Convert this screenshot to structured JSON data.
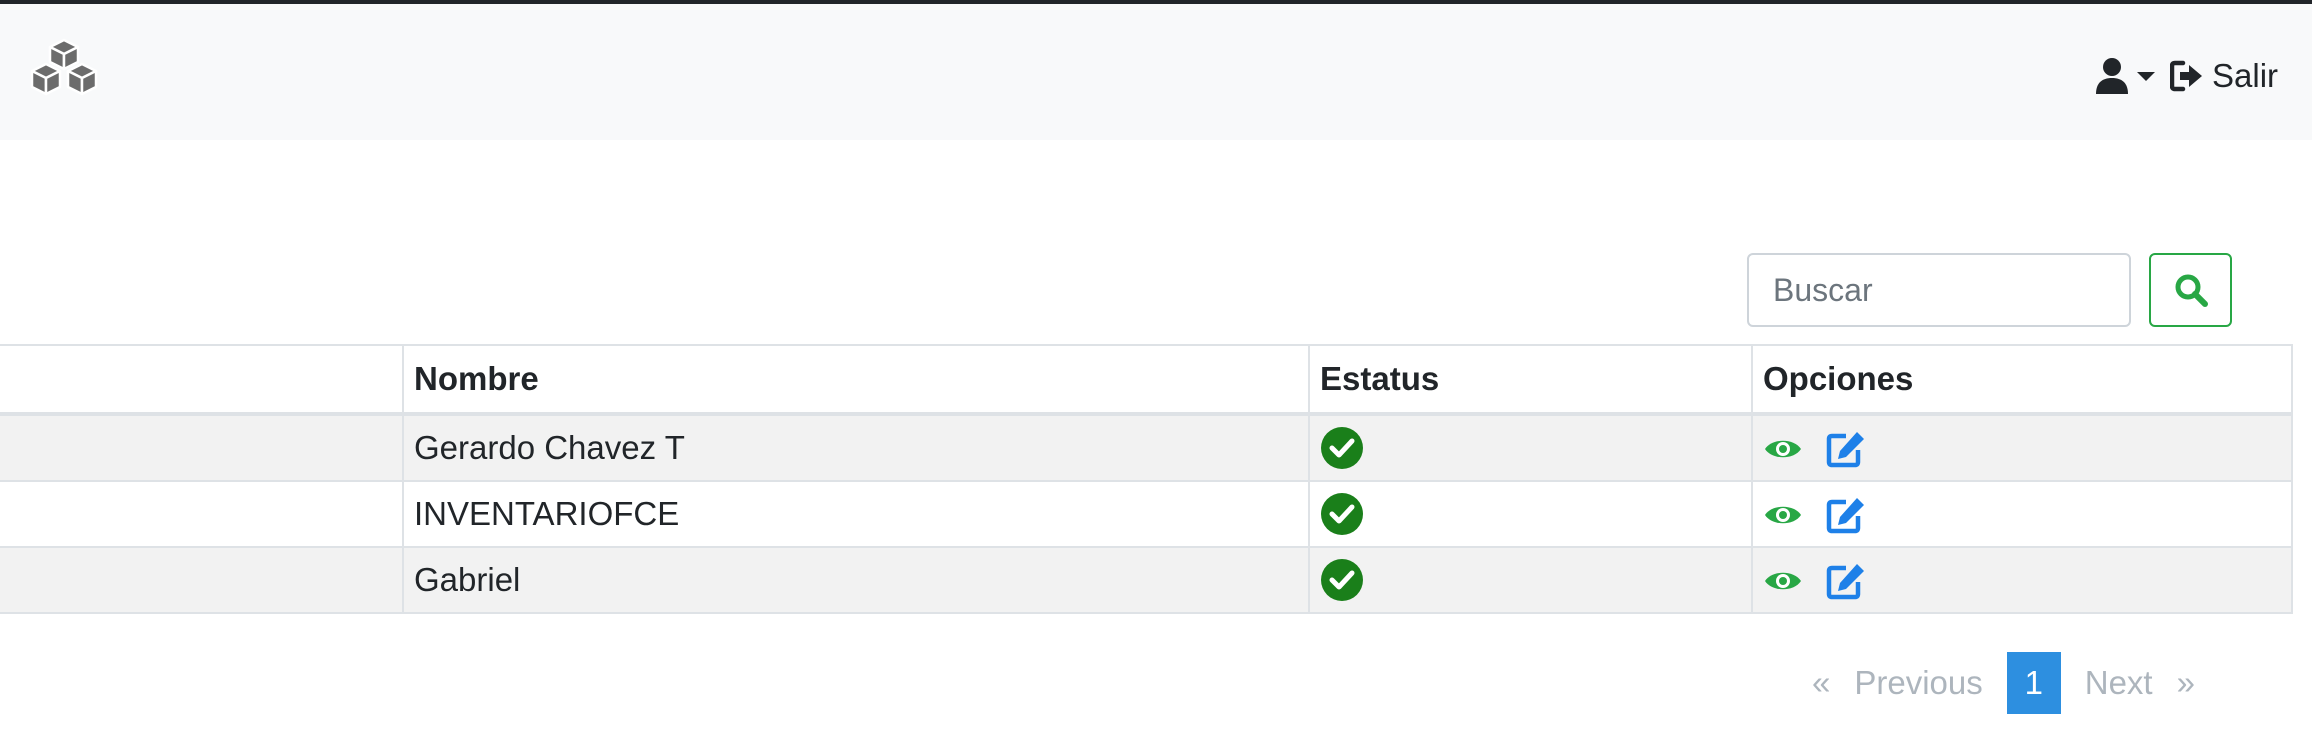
{
  "header": {
    "logo_icon": "cubes-icon",
    "user_icon": "user-icon",
    "dropdown_icon": "caret-down-icon",
    "logout_icon": "sign-out-icon",
    "logout_label": "Salir"
  },
  "search": {
    "placeholder": "Buscar",
    "value": "",
    "button_icon": "search-icon",
    "accent_color": "#28a745"
  },
  "table": {
    "columns": [
      "",
      "Nombre",
      "Estatus",
      "Opciones"
    ],
    "rows": [
      {
        "id": "",
        "nombre": "Gerardo Chavez T",
        "estatus_icon": "check-circle-icon",
        "options": [
          "eye-icon",
          "edit-icon"
        ]
      },
      {
        "id": "",
        "nombre": "INVENTARIOFCE",
        "estatus_icon": "check-circle-icon",
        "options": [
          "eye-icon",
          "edit-icon"
        ]
      },
      {
        "id": "",
        "nombre": "Gabriel",
        "estatus_icon": "check-circle-icon",
        "options": [
          "eye-icon",
          "edit-icon"
        ]
      }
    ],
    "status_color": "#1a7f1a",
    "view_color": "#28a745",
    "edit_color": "#1e80e8"
  },
  "pagination": {
    "first": "«",
    "previous": "Previous",
    "current": "1",
    "next": "Next",
    "last": "»",
    "active_color": "#2d8fe0"
  }
}
